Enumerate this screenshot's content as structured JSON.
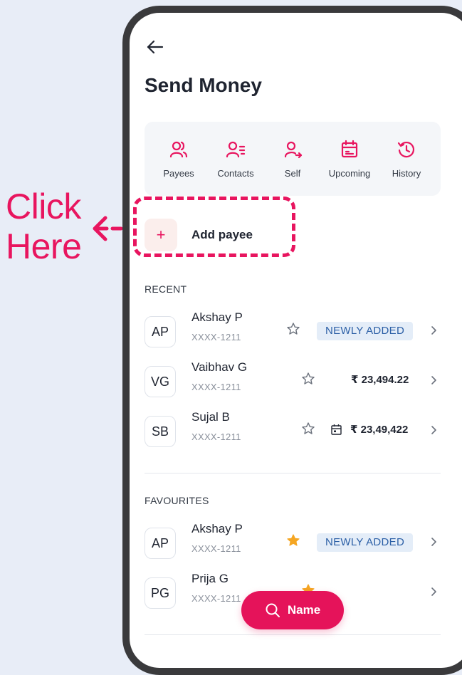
{
  "annotation": {
    "line1": "Click",
    "line2": "Here"
  },
  "header": {
    "title": "Send Money"
  },
  "quick_actions": [
    {
      "label": "Payees",
      "icon": "payees-icon"
    },
    {
      "label": "Contacts",
      "icon": "contacts-icon"
    },
    {
      "label": "Self",
      "icon": "self-icon"
    },
    {
      "label": "Upcoming",
      "icon": "calendar-icon"
    },
    {
      "label": "History",
      "icon": "history-icon"
    }
  ],
  "add_payee": {
    "plus": "+",
    "label": "Add payee"
  },
  "recent": {
    "label": "RECENT",
    "rows": [
      {
        "initials": "AP",
        "name": "Akshay P",
        "account": "XXXX-1211",
        "badge": "NEWLY ADDED",
        "favourite": false
      },
      {
        "initials": "VG",
        "name": "Vaibhav G",
        "account": "XXXX-1211",
        "amount": "₹ 23,494.22",
        "favourite": false
      },
      {
        "initials": "SB",
        "name": "Sujal B",
        "account": "XXXX-1211",
        "amount": "₹ 23,49,422",
        "scheduled": true,
        "favourite": false
      }
    ]
  },
  "favourites": {
    "label": "FAVOURITES",
    "rows": [
      {
        "initials": "AP",
        "name": "Akshay P",
        "account": "XXXX-1211",
        "badge": "NEWLY ADDED",
        "favourite": true
      },
      {
        "initials": "PG",
        "name": "Prija G",
        "account": "XXXX-1211",
        "favourite": true
      }
    ]
  },
  "search_fab": {
    "label": "Name"
  },
  "colors": {
    "accent": "#e8155f",
    "badge_bg": "#e4edf8",
    "badge_text": "#2b5fa6",
    "star_filled": "#f5a623"
  }
}
